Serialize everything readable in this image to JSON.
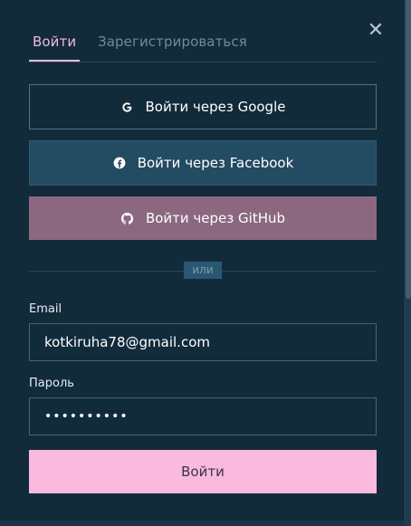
{
  "close_icon": "close-icon",
  "tabs": {
    "login": "Войти",
    "register": "Зарегистрироваться"
  },
  "oauth": {
    "google": {
      "label": "Войти через Google",
      "icon": "google-icon"
    },
    "facebook": {
      "label": "Войти через Facebook",
      "icon": "facebook-icon"
    },
    "github": {
      "label": "Войти через GitHub",
      "icon": "github-icon"
    }
  },
  "divider": {
    "label": "или"
  },
  "form": {
    "email_label": "Email",
    "email_value": "kotkiruha78@gmail.com",
    "password_label": "Пароль",
    "password_value": "••••••••••",
    "submit_label": "Войти"
  },
  "colors": {
    "background": "#122b3b",
    "accent_pink": "#fab9df",
    "facebook": "#234b62",
    "github": "#8b6880"
  }
}
